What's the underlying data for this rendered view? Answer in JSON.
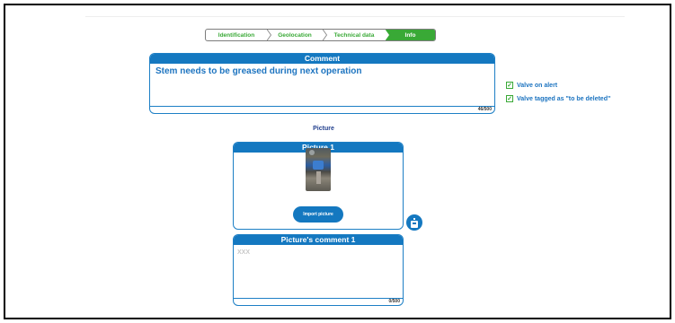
{
  "stepper": {
    "steps": [
      {
        "label": "Identification",
        "active": false
      },
      {
        "label": "Geolocation",
        "active": false
      },
      {
        "label": "Technical data",
        "active": false
      },
      {
        "label": "Info",
        "active": true
      }
    ]
  },
  "comment": {
    "title": "Comment",
    "text": "Stem needs to be greased during next operation",
    "counter": "46/500"
  },
  "checks": [
    {
      "label": "Valve on alert",
      "checked": true
    },
    {
      "label": "Valve tagged as \"to be deleted\"",
      "checked": true
    }
  ],
  "picture_section": {
    "label": "Picture"
  },
  "picture1": {
    "title": "Picture 1",
    "import_label": "Import picture"
  },
  "picture_comment1": {
    "title": "Picture's comment 1",
    "placeholder": "XXX",
    "counter": "0/500"
  },
  "icons": {
    "save": "save-icon",
    "checkmark": "checkmark-icon"
  },
  "colors": {
    "primary": "#1478c0",
    "success": "#39a936",
    "label": "#23408e"
  }
}
